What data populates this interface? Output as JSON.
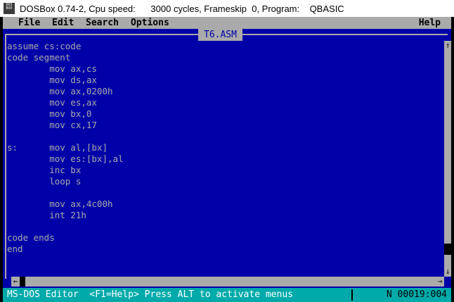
{
  "window": {
    "icon_text": "DOS BOX",
    "title": "DOSBox 0.74-2, Cpu speed:      3000 cycles, Frameskip  0, Program:    QBASIC"
  },
  "menu": {
    "file": "File",
    "edit": "Edit",
    "search": "Search",
    "options": "Options",
    "help": "Help"
  },
  "editor": {
    "filename": "T6.ASM",
    "lines": [
      "assume cs:code",
      "code segment",
      "        mov ax,cs",
      "        mov ds,ax",
      "        mov ax,0200h",
      "        mov es,ax",
      "        mov bx,0",
      "        mov cx,17",
      "",
      "s:      mov al,[bx]",
      "        mov es:[bx],al",
      "        inc bx",
      "        loop s",
      "",
      "        mov ax,4c00h",
      "        int 21h",
      "",
      "code ends",
      "end"
    ]
  },
  "scrollbars": {
    "up": "↑",
    "down": "↓",
    "left": "←",
    "right": "→"
  },
  "status": {
    "text": "MS-DOS Editor  <F1=Help> Press ALT to activate menus",
    "position": "N 00019:004"
  },
  "colors": {
    "editor_background": "#0000a8",
    "text": "#aaaaaa",
    "menu_background": "#aaaaaa",
    "status_background": "#00aaaa"
  }
}
